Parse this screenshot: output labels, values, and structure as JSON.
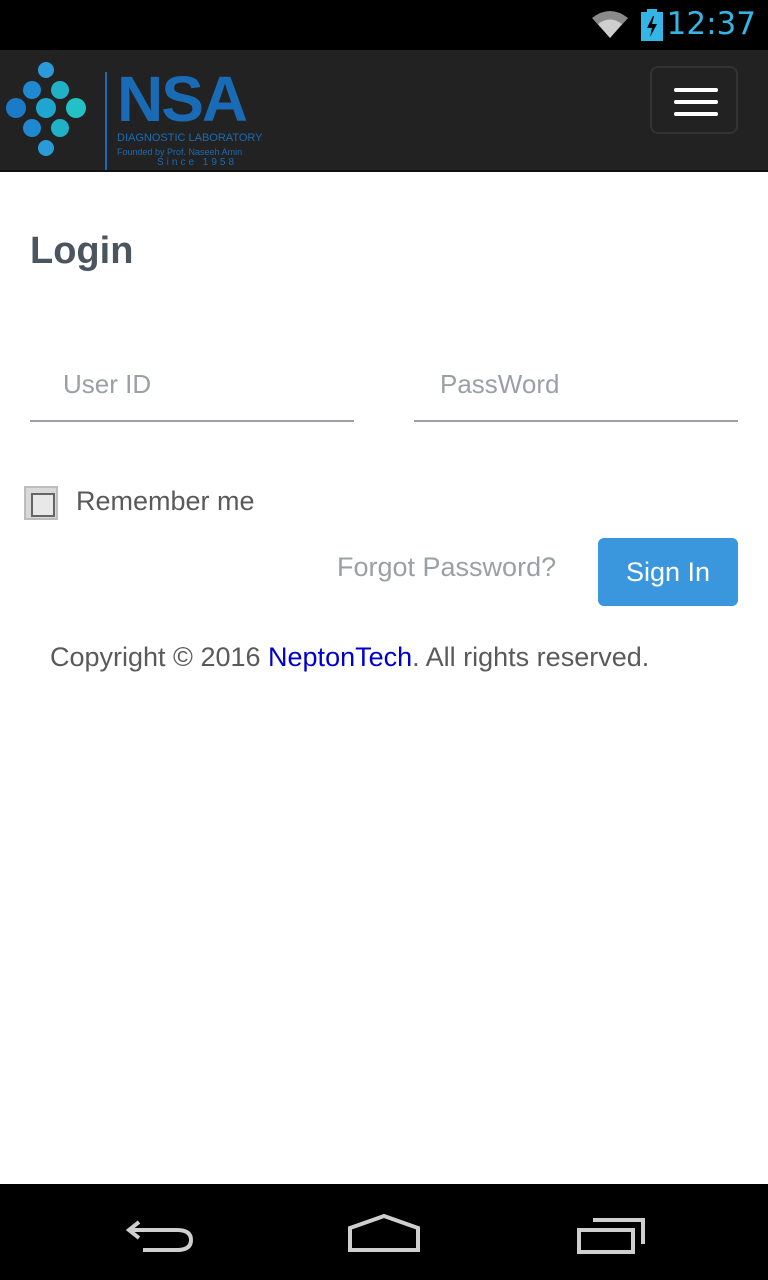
{
  "status": {
    "time": "12:37"
  },
  "brand": {
    "name": "NSA",
    "subtitle": "DIAGNOSTIC LABORATORY",
    "founder": "Founded by Prof. Naseeh Amin",
    "since": "Since 1958"
  },
  "login": {
    "title": "Login",
    "userid_placeholder": "User ID",
    "password_placeholder": "PassWord",
    "remember_label": "Remember me",
    "forgot_label": "Forgot Password?",
    "signin_label": "Sign In"
  },
  "footer": {
    "prefix": "Copyright © 2016 ",
    "company": "NeptonTech",
    "suffix": ". All rights reserved."
  },
  "colors": {
    "accent": "#3a96dd",
    "brand": "#1a6bb5",
    "status_time": "#33b5e5",
    "link": "#0000cc"
  }
}
